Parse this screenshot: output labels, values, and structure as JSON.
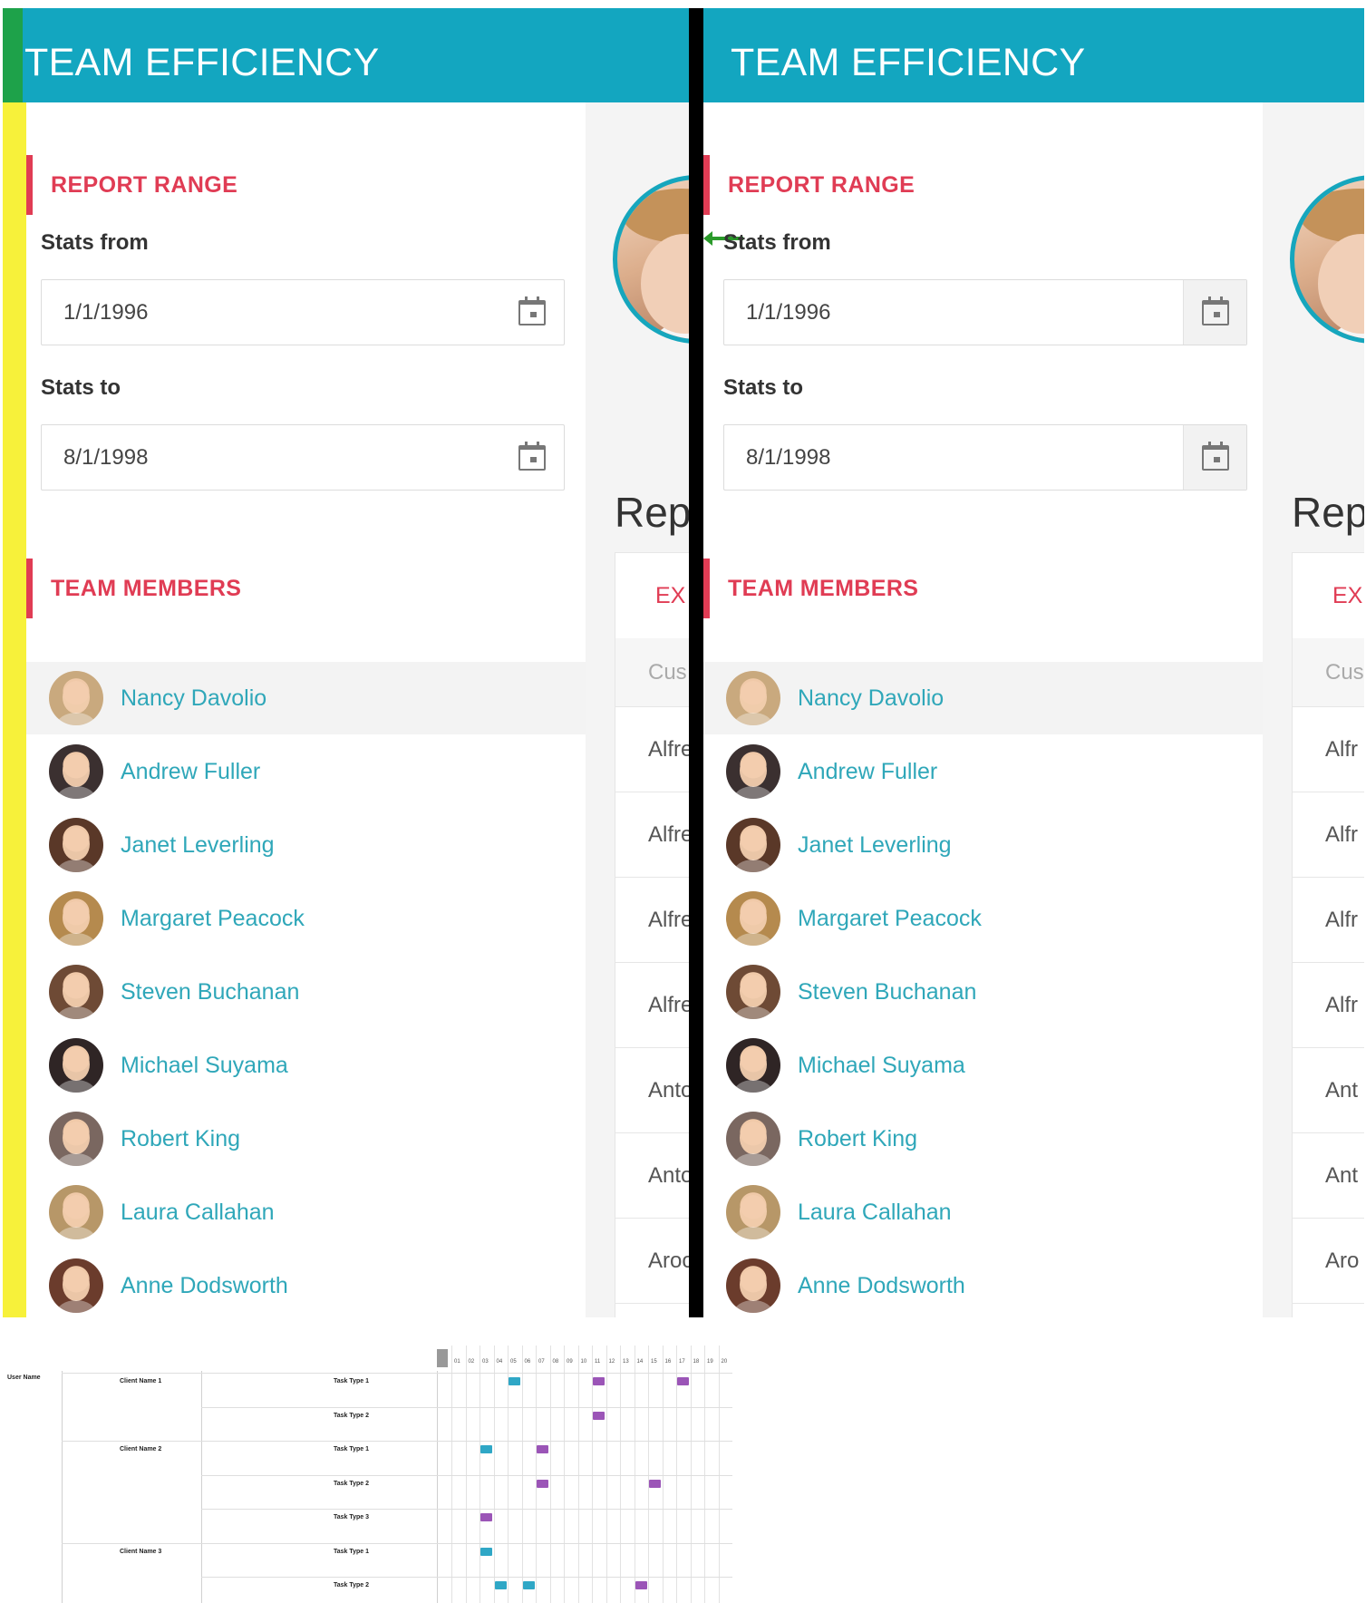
{
  "app_title": "TEAM EFFICIENCY",
  "report_range": {
    "heading": "REPORT RANGE",
    "stats_from_label": "Stats from",
    "stats_from_value": "1/1/1996",
    "stats_to_label": "Stats to",
    "stats_to_value": "8/1/1998"
  },
  "team_members": {
    "heading": "TEAM MEMBERS",
    "members": [
      {
        "name": "Nancy Davolio",
        "color": "#c9a97e"
      },
      {
        "name": "Andrew Fuller",
        "color": "#3b3030"
      },
      {
        "name": "Janet Leverling",
        "color": "#5a3828"
      },
      {
        "name": "Margaret Peacock",
        "color": "#b58a4e"
      },
      {
        "name": "Steven Buchanan",
        "color": "#6e4a35"
      },
      {
        "name": "Michael Suyama",
        "color": "#2f2525"
      },
      {
        "name": "Robert King",
        "color": "#7a6760"
      },
      {
        "name": "Laura Callahan",
        "color": "#b79768"
      },
      {
        "name": "Anne Dodsworth",
        "color": "#6b3c2c"
      }
    ]
  },
  "report_panel": {
    "heading": "Rep",
    "export_label": "EX",
    "column_header": "Cus",
    "rows_left": [
      "Alfre",
      "Alfre",
      "Alfre",
      "Alfre",
      "Anto",
      "Anto",
      "Aroo"
    ],
    "rows_right": [
      "Alfr",
      "Alfr",
      "Alfr",
      "Alfr",
      "Ant",
      "Ant",
      "Aro"
    ]
  },
  "colors": {
    "header": "#13a6c0",
    "accent_red": "#e03c54",
    "member_link": "#2fa7b9",
    "gantt_bar_a": "#2fa7c6",
    "gantt_bar_b": "#9b55b7"
  },
  "gantt": {
    "user_name_label": "User Name",
    "clients": [
      "Client Name 1",
      "Client Name 2",
      "Client Name 3"
    ],
    "tasks": [
      "Task Type 1",
      "Task Type 2",
      "Task Type 1",
      "Task Type 2",
      "Task Type 3",
      "Task Type 1",
      "Task Type 2"
    ],
    "timeline_ticks": [
      "01",
      "02",
      "03",
      "04",
      "05",
      "06",
      "07",
      "08",
      "09",
      "10",
      "11",
      "12",
      "13",
      "14",
      "15",
      "16",
      "17",
      "18",
      "19",
      "20"
    ],
    "bars": [
      {
        "row": 0,
        "slot": 4,
        "kind": "a"
      },
      {
        "row": 0,
        "slot": 10,
        "kind": "b"
      },
      {
        "row": 0,
        "slot": 16,
        "kind": "b"
      },
      {
        "row": 1,
        "slot": 10,
        "kind": "b"
      },
      {
        "row": 2,
        "slot": 2,
        "kind": "a"
      },
      {
        "row": 2,
        "slot": 6,
        "kind": "b"
      },
      {
        "row": 3,
        "slot": 6,
        "kind": "b"
      },
      {
        "row": 3,
        "slot": 14,
        "kind": "b"
      },
      {
        "row": 4,
        "slot": 2,
        "kind": "b"
      },
      {
        "row": 5,
        "slot": 2,
        "kind": "a"
      },
      {
        "row": 6,
        "slot": 3,
        "kind": "a"
      },
      {
        "row": 6,
        "slot": 5,
        "kind": "a"
      },
      {
        "row": 6,
        "slot": 13,
        "kind": "b"
      }
    ]
  }
}
